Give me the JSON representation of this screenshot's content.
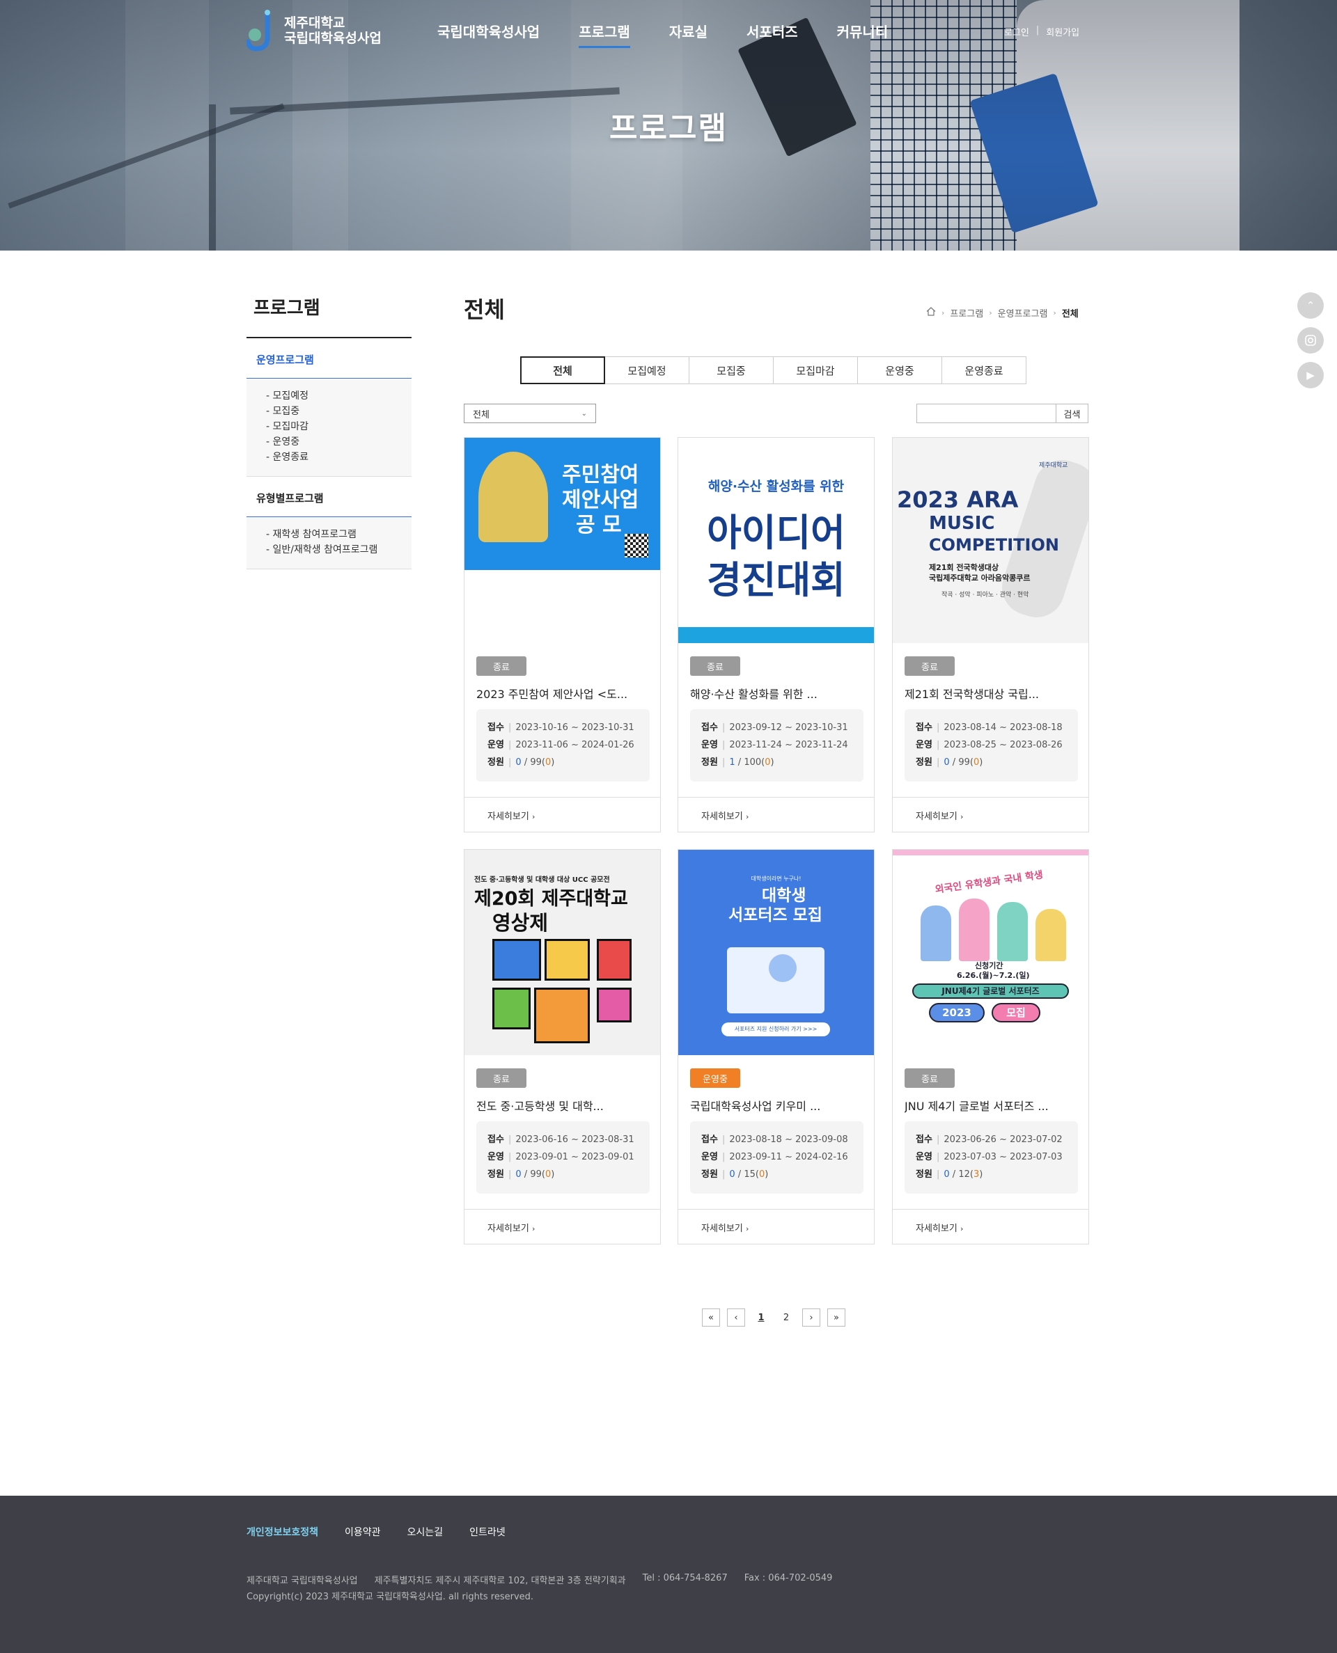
{
  "header": {
    "logo_line1": "제주대학교",
    "logo_line2": "국립대학육성사업",
    "nav": [
      "국립대학육성사업",
      "프로그램",
      "자료실",
      "서포터즈",
      "커뮤니티"
    ],
    "active_nav": "프로그램",
    "login": "로그인",
    "signup": "회원가입",
    "hero_title": "프로그램"
  },
  "sidebar": {
    "title": "프로그램",
    "groups": [
      {
        "label": "운영프로그램",
        "active": true,
        "items": [
          "모집예정",
          "모집중",
          "모집마감",
          "운영중",
          "운영종료"
        ]
      },
      {
        "label": "유형별프로그램",
        "active": false,
        "items": [
          "재학생 참여프로그램",
          "일반/재학생 참여프로그램"
        ]
      }
    ]
  },
  "main": {
    "title": "전체",
    "breadcrumb": [
      "프로그램",
      "운영프로그램",
      "전체"
    ],
    "tabs": [
      "전체",
      "모집예정",
      "모집중",
      "모집마감",
      "운영중",
      "운영종료"
    ],
    "active_tab": "전체",
    "filter_select": "전체",
    "search_button": "검색",
    "labels": {
      "receipt": "접수",
      "operate": "운영",
      "quota": "정원",
      "more": "자세히보기"
    },
    "cards": [
      {
        "status": "종료",
        "status_color": "#9a9a9a",
        "title": "2023 주민참여 제안사업 <도...",
        "receipt": "2023-10-16 ~ 2023-10-31",
        "operate": "2023-11-06 ~ 2024-01-26",
        "quota_cur": "0",
        "quota_max": "99",
        "quota_wait": "0",
        "poster": {
          "bg": "#1f8de6",
          "lines": [
            "주민참여",
            "제안사업",
            "공 모"
          ]
        }
      },
      {
        "status": "종료",
        "status_color": "#9a9a9a",
        "title": "해양·수산 활성화를 위한 ...",
        "receipt": "2023-09-12 ~ 2023-10-31",
        "operate": "2023-11-24 ~ 2023-11-24",
        "quota_cur": "1",
        "quota_max": "100",
        "quota_wait": "0",
        "poster": {
          "bg": "#ffffff",
          "lines": [
            "해양·수산 활성화를 위한",
            "아이디어",
            "경진대회"
          ]
        }
      },
      {
        "status": "종료",
        "status_color": "#9a9a9a",
        "title": "제21회 전국학생대상 국립...",
        "receipt": "2023-08-14 ~ 2023-08-18",
        "operate": "2023-08-25 ~ 2023-08-26",
        "quota_cur": "0",
        "quota_max": "99",
        "quota_wait": "0",
        "poster": {
          "bg": "#f3f3f3",
          "lines": [
            "2023 ARA",
            "MUSIC",
            "COMPETITION",
            "제21회 전국학생대상",
            "국립제주대학교 아라음악콩쿠르",
            "작곡 · 성악 · 피아노 · 관악 · 현악",
            "제주대학교"
          ]
        }
      },
      {
        "status": "종료",
        "status_color": "#9a9a9a",
        "title": "전도 중·고등학생 및 대학...",
        "receipt": "2023-06-16 ~ 2023-08-31",
        "operate": "2023-09-01 ~ 2023-09-01",
        "quota_cur": "0",
        "quota_max": "99",
        "quota_wait": "0",
        "poster": {
          "bg": "#f1f1f1",
          "lines": [
            "전도 중·고등학생 및 대학생 대상 UCC 공모전",
            "제20회 제주대학교",
            "영상제"
          ]
        }
      },
      {
        "status": "운영중",
        "status_color": "#f07f26",
        "title": "국립대학육성사업 키우미 ...",
        "receipt": "2023-08-18 ~ 2023-09-08",
        "operate": "2023-09-11 ~ 2024-02-16",
        "quota_cur": "0",
        "quota_max": "15",
        "quota_wait": "0",
        "poster": {
          "bg": "#3f7be0",
          "lines": [
            "대학생이라면 누구나!",
            "대학생",
            "서포터즈 모집",
            "서포터즈 지원 신청하러 가기 >>>"
          ]
        }
      },
      {
        "status": "종료",
        "status_color": "#9a9a9a",
        "title": "JNU 제4기 글로벌 서포터즈 ...",
        "receipt": "2023-06-26 ~ 2023-07-02",
        "operate": "2023-07-03 ~ 2023-07-03",
        "quota_cur": "0",
        "quota_max": "12",
        "quota_wait": "3",
        "poster": {
          "bg": "#ffffff",
          "lines": [
            "외국인 유학생과 국내 학생",
            "신청기간",
            "6.26.(월)~7.2.(일)",
            "JNU제4기 글로벌 서포터즈",
            "2023",
            "모집"
          ]
        }
      }
    ]
  },
  "pagination": {
    "pages": [
      "1",
      "2"
    ],
    "current": "1",
    "first": "«",
    "prev": "‹",
    "next": "›",
    "last": "»"
  },
  "footer": {
    "links": [
      "개인정보보호정책",
      "이용약관",
      "오시는길",
      "인트라넷"
    ],
    "org": "제주대학교 국립대학육성사업",
    "address": "제주특별자치도 제주시 제주대학로 102, 대학본관 3층 전략기획과",
    "tel": "Tel : 064-754-8267",
    "fax": "Fax : 064-702-0549",
    "copyright": "Copyright(c) 2023 제주대학교 국립대학육성사업. all rights reserved."
  }
}
